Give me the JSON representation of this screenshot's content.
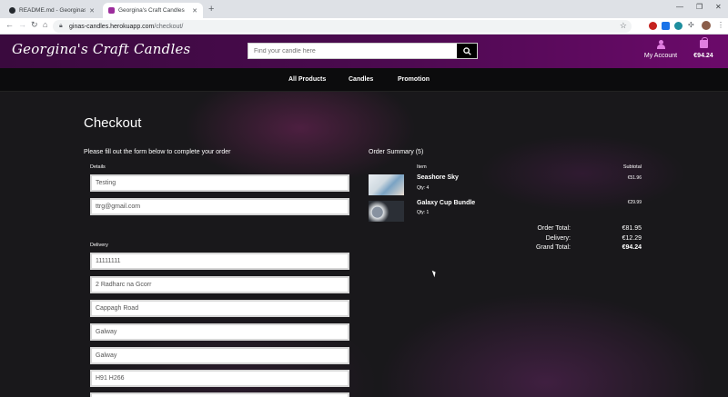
{
  "browser": {
    "tabs": [
      {
        "title": "README.md - Georginas_Craft..."
      },
      {
        "title": "Georgina's Craft Candles"
      }
    ],
    "url_host": "ginas-candles.herokuapp.com",
    "url_path": "/checkout/",
    "colors": {
      "ext_red": "#c5221f",
      "ext_blue": "#1a73e8",
      "ext_teal": "#1e8e9e",
      "ext_gray": "#5f6368"
    }
  },
  "site": {
    "logo": "Georgina's Craft Candles",
    "search_placeholder": "Find your candle here",
    "account_label": "My Account",
    "bag_total": "€94.24",
    "nav": [
      "All Products",
      "Candles",
      "Promotion"
    ],
    "colors": {
      "header_start": "#3a0a3e",
      "header_end": "#6b0a6a",
      "accent_icon": "#e07ee0"
    }
  },
  "checkout": {
    "title": "Checkout",
    "instructions": "Please fill out the form below to complete your order",
    "details_label": "Details",
    "delivery_label": "Delivery",
    "details_fields": [
      "Testing",
      "ttrg@gmail.com"
    ],
    "delivery_fields": [
      "11111111",
      "2 Radharc na Gcorr",
      "Cappagh Road",
      "Galway",
      "Galway",
      "H91 H266"
    ]
  },
  "summary": {
    "title": "Order Summary (5)",
    "col_item": "Item",
    "col_subtotal": "Subtotal",
    "items": [
      {
        "name": "Seashore Sky",
        "qty": "Qty: 4",
        "subtotal": "€51.96"
      },
      {
        "name": "Galaxy Cup Bundle",
        "qty": "Qty: 1",
        "subtotal": "€29.99"
      }
    ],
    "order_total_label": "Order Total:",
    "order_total": "€81.95",
    "delivery_label": "Delivery:",
    "delivery": "€12.29",
    "grand_total_label": "Grand Total:",
    "grand_total": "€94.24"
  }
}
